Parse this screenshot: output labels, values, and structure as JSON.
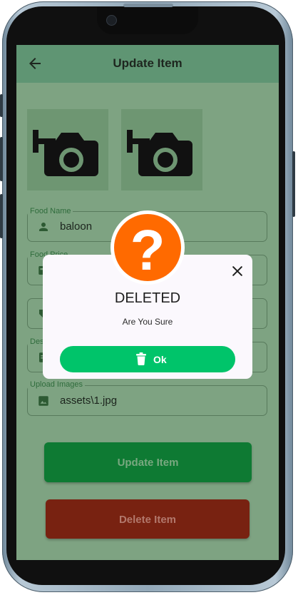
{
  "app_bar": {
    "title": "Update Item"
  },
  "form": {
    "food_name": {
      "label": "Food Name",
      "value": "baloon"
    },
    "food_price": {
      "label": "Food Price",
      "value": ""
    },
    "category": {
      "label": "",
      "value": ""
    },
    "description": {
      "label": "Description",
      "value": ""
    },
    "upload_images": {
      "label": "Upload Images",
      "value": "assets\\1.jpg"
    }
  },
  "buttons": {
    "update": "Update Item",
    "delete": "Delete Item"
  },
  "dialog": {
    "badge_glyph": "?",
    "title": "DELETED",
    "message": "Are You Sure",
    "ok_label": "Ok"
  },
  "colors": {
    "accent_green": "#00c46a",
    "badge_orange": "#ff6a00",
    "update_green": "#0e7a33",
    "delete_red": "#782211"
  },
  "icons": [
    "back-arrow-icon",
    "add-photo-icon",
    "person-icon",
    "image-icon",
    "close-icon",
    "trash-icon",
    "question-mark-icon"
  ]
}
